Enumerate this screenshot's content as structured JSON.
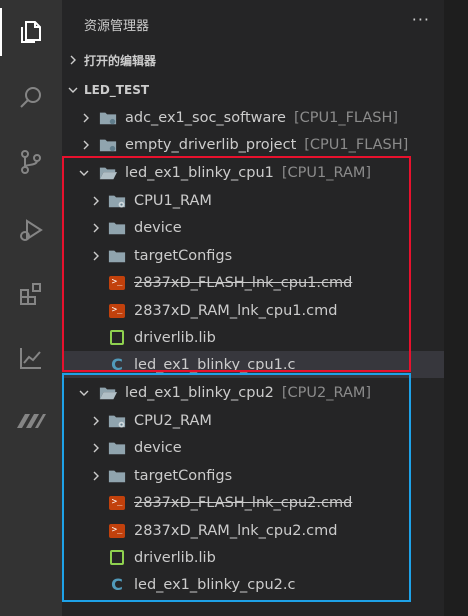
{
  "explorer": {
    "title": "资源管理器",
    "more": "···",
    "open_editors": "打开的编辑器",
    "project": "LED_TEST"
  },
  "tree": {
    "adc": {
      "name": "adc_ex1_soc_software",
      "desc": "[CPU1_FLASH]"
    },
    "empty": {
      "name": "empty_driverlib_project",
      "desc": "[CPU1_FLASH]"
    },
    "cpu1": {
      "name": "led_ex1_blinky_cpu1",
      "desc": "[CPU1_RAM]",
      "ram": "CPU1_RAM",
      "device": "device",
      "target": "targetConfigs",
      "flash_cmd": "2837xD_FLASH_lnk_cpu1.cmd",
      "ram_cmd": "2837xD_RAM_lnk_cpu1.cmd",
      "lib": "driverlib.lib",
      "c": "led_ex1_blinky_cpu1.c"
    },
    "cpu2": {
      "name": "led_ex1_blinky_cpu2",
      "desc": "[CPU2_RAM]",
      "ram": "CPU2_RAM",
      "device": "device",
      "target": "targetConfigs",
      "flash_cmd": "2837xD_FLASH_lnk_cpu2.cmd",
      "ram_cmd": "2837xD_RAM_lnk_cpu2.cmd",
      "lib": "driverlib.lib",
      "c": "led_ex1_blinky_cpu2.c"
    }
  },
  "icons": {
    "cmd": ">_",
    "c": "C"
  },
  "colors": {
    "activity_bar": "#333333",
    "sidebar": "#252526",
    "highlight_cpu1": "#e8112d",
    "highlight_cpu2": "#1ea2e8",
    "cmd_icon": "#c2410c",
    "lib_icon": "#8fd14f",
    "c_icon": "#519aba"
  }
}
